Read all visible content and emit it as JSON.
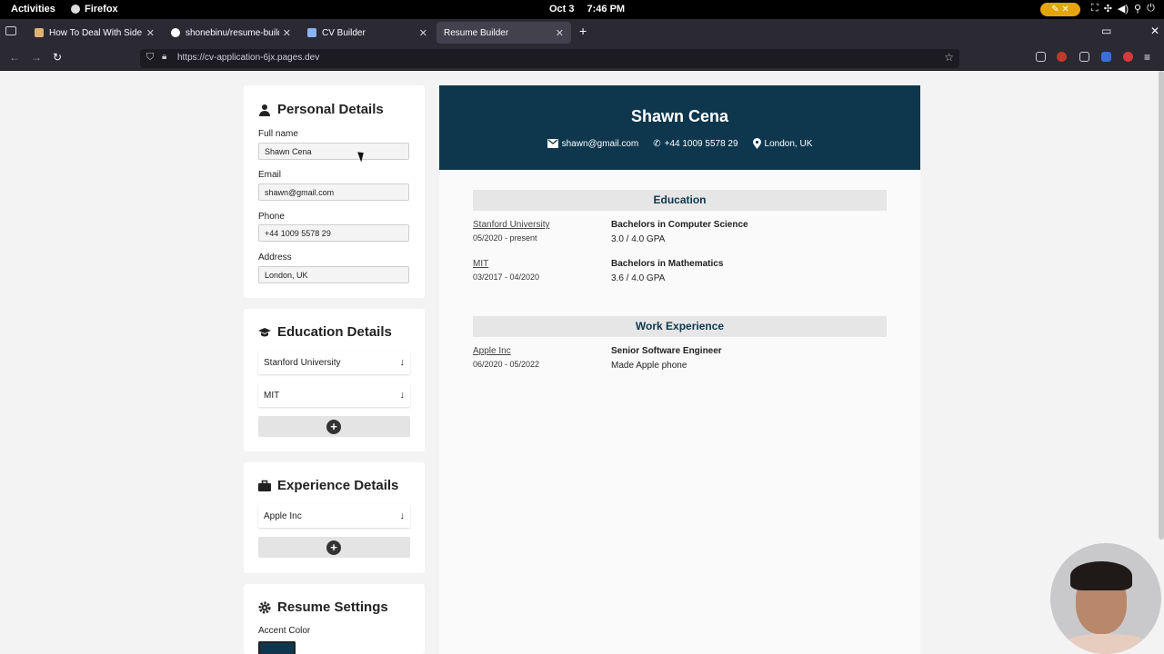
{
  "topbar": {
    "activities": "Activities",
    "app": "Firefox",
    "date": "Oct 3",
    "time": "7:46 PM",
    "pill_close": "✕"
  },
  "tabs": [
    {
      "title": "How To Deal With Side Ef",
      "favicon_color": "#e0b074",
      "close": "✕"
    },
    {
      "title": "shonebinu/resume-builde",
      "favicon_color": "#ffffff",
      "close": "✕"
    },
    {
      "title": "CV Builder",
      "favicon_color": "#8ab4f8",
      "close": "✕"
    },
    {
      "title": "Resume Builder",
      "favicon_color": "#42414d",
      "close": "✕"
    }
  ],
  "browser": {
    "new_tab": "+",
    "url": "https://cv-application-6jx.pages.dev",
    "window_close": "✕",
    "window_tabs": "▭"
  },
  "personal": {
    "heading": "Personal Details",
    "fields": [
      {
        "label": "Full name",
        "value": "Shawn Cena"
      },
      {
        "label": "Email",
        "value": "shawn@gmail.com"
      },
      {
        "label": "Phone",
        "value": "+44 1009 5578 29"
      },
      {
        "label": "Address",
        "value": "London, UK"
      }
    ]
  },
  "education_panel": {
    "heading": "Education Details",
    "items": [
      "Stanford University",
      "MIT"
    ],
    "add": "+"
  },
  "experience_panel": {
    "heading": "Experience Details",
    "items": [
      "Apple Inc"
    ],
    "add": "+"
  },
  "settings": {
    "heading": "Resume Settings",
    "accent_label": "Accent Color",
    "accent_color": "#0e374e"
  },
  "resume": {
    "name": "Shawn Cena",
    "email": "shawn@gmail.com",
    "phone": "+44 1009 5578 29",
    "address": "London, UK",
    "accent_color": "#0e374e",
    "education_title": "Education",
    "education": [
      {
        "school": "Stanford University",
        "dates": "05/2020 - present",
        "degree": "Bachelors in Computer Science",
        "gpa": "3.0 / 4.0 GPA"
      },
      {
        "school": "MIT",
        "dates": "03/2017 - 04/2020",
        "degree": "Bachelors in Mathematics",
        "gpa": "3.6 / 4.0 GPA"
      }
    ],
    "work_title": "Work Experience",
    "work": [
      {
        "company": "Apple Inc",
        "dates": "06/2020 - 05/2022",
        "role": "Senior Software Engineer",
        "desc": "Made Apple phone"
      }
    ]
  }
}
